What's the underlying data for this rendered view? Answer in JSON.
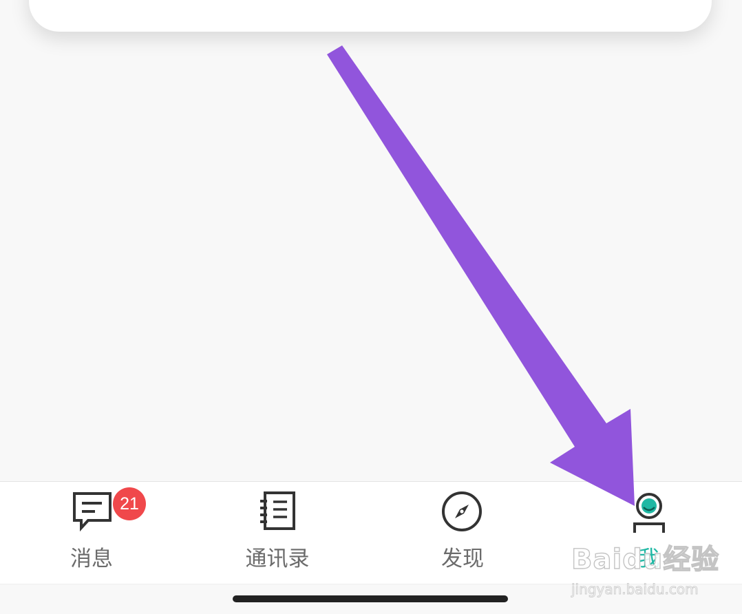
{
  "tabbar": {
    "tabs": [
      {
        "label": "消息",
        "icon": "message-icon",
        "badge": "21",
        "active": false
      },
      {
        "label": "通讯录",
        "icon": "contacts-book-icon",
        "active": false
      },
      {
        "label": "发现",
        "icon": "compass-icon",
        "active": false
      },
      {
        "label": "我",
        "icon": "profile-icon",
        "active": true
      }
    ]
  },
  "watermark": {
    "main": "Baidu经验",
    "sub": "jingyan.baidu.com"
  },
  "colors": {
    "accent": "#1fb8a4",
    "badge": "#f0484b",
    "arrow": "#9155dc",
    "icon": "#333333",
    "label": "#6b6b6b"
  }
}
